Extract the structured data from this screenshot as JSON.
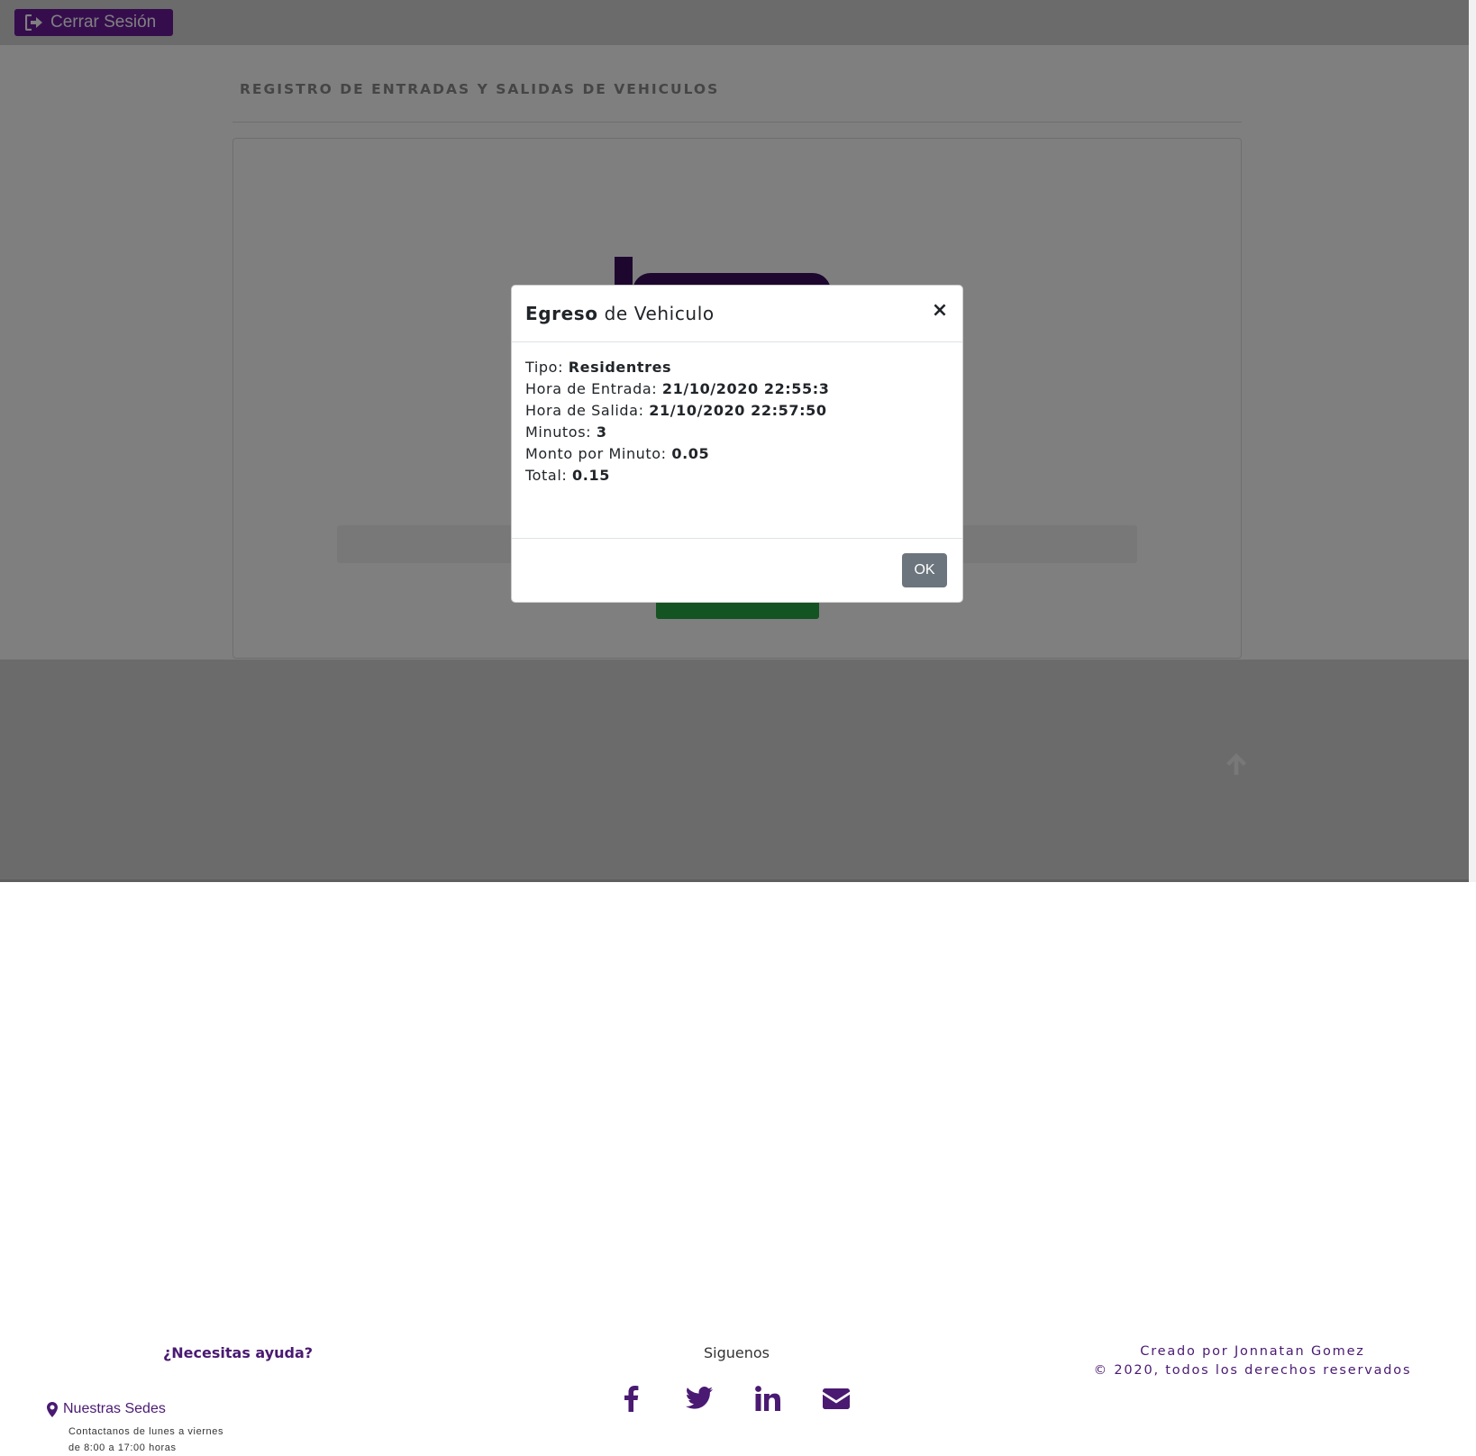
{
  "topbar": {
    "logout_label": "Cerrar Sesión"
  },
  "main": {
    "heading": "REGISTRO DE ENTRADAS Y SALIDAS DE VEHICULOS"
  },
  "modal": {
    "title_bold": "Egreso",
    "title_rest": " de Vehiculo",
    "close_glyph": "×",
    "fields": [
      {
        "label": "Tipo: ",
        "value": "Residentres"
      },
      {
        "label": "Hora de Entrada: ",
        "value": "21/10/2020 22:55:3"
      },
      {
        "label": "Hora de Salida: ",
        "value": "21/10/2020 22:57:50"
      },
      {
        "label": "Minutos: ",
        "value": "3"
      },
      {
        "label": "Monto por Minuto: ",
        "value": "0.05"
      },
      {
        "label": "Total: ",
        "value": "0.15"
      }
    ],
    "ok_label": "OK"
  },
  "footer": {
    "help_title": "¿Necesitas ayuda?",
    "sedes_title": "Nuestras Sedes",
    "sedes_line1": "Contactanos de lunes a viernes",
    "sedes_line2": "de 8:00 a 17:00 horas",
    "follow_title": "Siguenos",
    "socials": [
      "facebook-icon",
      "twitter-icon",
      "linkedin-icon",
      "envelope-icon"
    ],
    "credit_line1": "Creado por Jonnatan Gomez",
    "credit_line2": "© 2020, todos los derechos reservados"
  },
  "colors": {
    "brand": "#6a1b9a",
    "accent_text": "#4a1a72",
    "success": "#28a745",
    "ok_button": "#6c757d"
  }
}
